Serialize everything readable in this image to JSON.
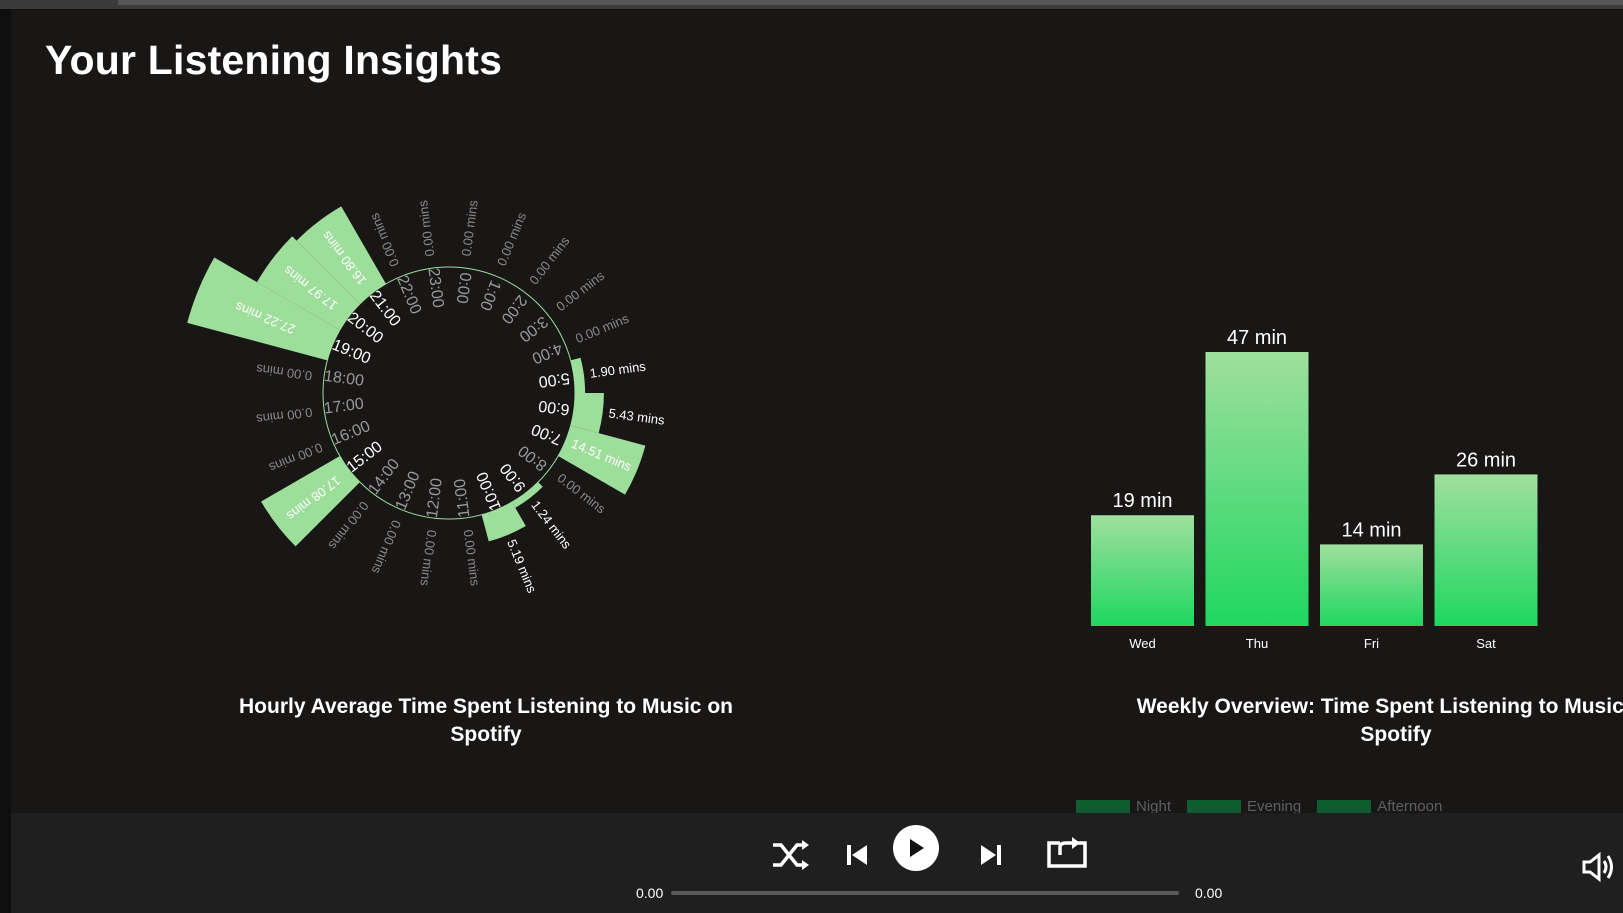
{
  "page": {
    "title": "Your Listening Insights"
  },
  "radial": {
    "title": "Hourly Average Time Spent Listening to Music on Spotify",
    "color": "#9ede9b",
    "chart_data": {
      "type": "bar",
      "categories": [
        "0:00",
        "1:00",
        "2:00",
        "3:00",
        "4:00",
        "5:00",
        "6:00",
        "7:00",
        "8:00",
        "9:00",
        "10:00",
        "11:00",
        "12:00",
        "13:00",
        "14:00",
        "15:00",
        "16:00",
        "17:00",
        "18:00",
        "19:00",
        "20:00",
        "21:00",
        "22:00",
        "23:00"
      ],
      "values": [
        0,
        0,
        0,
        0,
        0,
        1.9,
        5.43,
        14.51,
        0,
        1.24,
        5.19,
        0,
        0,
        0,
        0,
        17.08,
        0,
        0,
        0,
        27.22,
        17.97,
        16.8,
        0,
        0
      ],
      "value_labels": [
        "0.00 mins",
        "0.00 mins",
        "0.00 mins",
        "0.00 mins",
        "0.00 mins",
        "1.90 mins",
        "5.43 mins",
        "14.51 mins",
        "0.00 mins",
        "1.24 mins",
        "5.19 mins",
        "0.00 mins",
        "0.00 mins",
        "0.00 mins",
        "0.00 mins",
        "17.08 mins",
        "0.00 mins",
        "0.00 mins",
        "0.00 mins",
        "27.22 mins",
        "17.97 mins",
        "16.80 mins",
        "0.00 mins",
        "0.00 mins"
      ],
      "ylabel": "mins"
    }
  },
  "weekly": {
    "title": "Weekly Overview: Time Spent Listening to Music on Spotify",
    "colors": {
      "top": "#a0df9e",
      "bottom": "#1ed760"
    },
    "chart_data": {
      "type": "bar",
      "categories": [
        "Wed",
        "Thu",
        "Fri",
        "Sat"
      ],
      "values": [
        19,
        47,
        14,
        26
      ],
      "value_labels": [
        "19 min",
        "47 min",
        "14 min",
        "26 min"
      ],
      "ylim": [
        0,
        47
      ]
    }
  },
  "legend": {
    "items": [
      {
        "label": "Night",
        "color": "#0f5c31"
      },
      {
        "label": "Evening",
        "color": "#0f5c31"
      },
      {
        "label": "Afternoon",
        "color": "#0f5c31"
      }
    ]
  },
  "player": {
    "elapsed": "0.00",
    "duration": "0.00",
    "progress": 0,
    "icons": {
      "shuffle": "shuffle-icon",
      "previous": "skip-previous-icon",
      "play": "play-icon",
      "next": "skip-next-icon",
      "repeat": "repeat-icon",
      "volume": "volume-icon"
    }
  }
}
